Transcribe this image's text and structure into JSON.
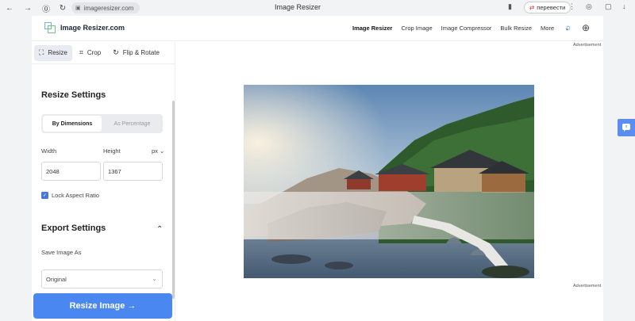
{
  "browser": {
    "url": "imageresizer.com",
    "tab_title": "Image Resizer",
    "translate_label": "перевести"
  },
  "site": {
    "logo_text": "Image Resizer.com",
    "nav": [
      "Image Resizer",
      "Crop Image",
      "Image Compressor",
      "Bulk Resize",
      "More"
    ]
  },
  "panel": {
    "tabs": [
      "Resize",
      "Crop",
      "Flip & Rotate"
    ],
    "resize_settings_title": "Resize Settings",
    "mode_by_dimensions": "By Dimensions",
    "mode_as_percentage": "As Percentage",
    "width_label": "Width",
    "height_label": "Height",
    "unit": "px",
    "width_value": "2048",
    "height_value": "1367",
    "lock_label": "Lock Aspect Ratio",
    "export_title": "Export Settings",
    "save_as_label": "Save Image As",
    "save_as_value": "Original",
    "resize_button": "Resize Image →"
  },
  "preview": {
    "ad_top": "Advertisement",
    "ad_bottom": "Advertisement"
  }
}
